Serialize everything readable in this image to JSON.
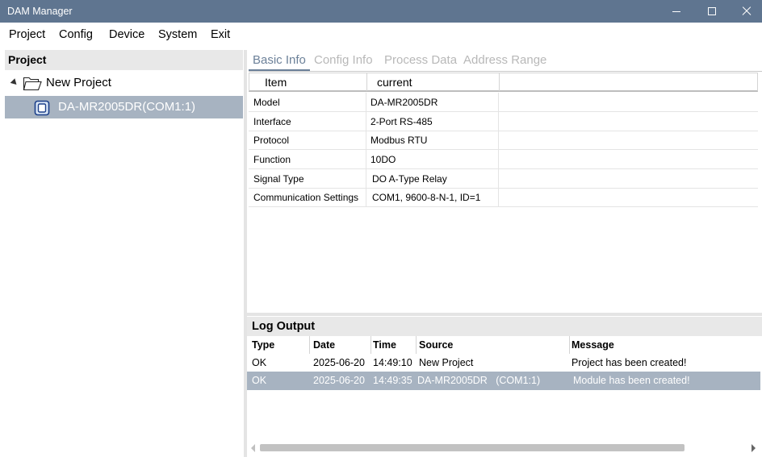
{
  "window": {
    "title": "DAM Manager"
  },
  "menu": [
    "Project",
    "Config",
    "Device",
    "System",
    "Exit"
  ],
  "project_panel": {
    "header": "Project",
    "tree": {
      "root": "New Project",
      "device": "DA-MR2005DR(COM1:1)"
    }
  },
  "tabs": [
    {
      "label": "Basic Info",
      "active": true
    },
    {
      "label": "Config Info",
      "active": false
    },
    {
      "label": "Process Data",
      "active": false
    },
    {
      "label": "Address Range",
      "active": false
    }
  ],
  "info_table": {
    "columns": [
      "Item",
      "current"
    ],
    "rows": [
      [
        "Model",
        "DA-MR2005DR"
      ],
      [
        "Interface",
        "2-Port RS-485"
      ],
      [
        "Protocol",
        "Modbus RTU"
      ],
      [
        "Function",
        "10DO"
      ],
      [
        "Signal Type",
        "DO A-Type Relay"
      ],
      [
        "Communication Settings",
        "COM1, 9600-8-N-1, ID=1"
      ]
    ]
  },
  "log": {
    "header": "Log Output",
    "columns": [
      "Type",
      "Date",
      "Time",
      "Source",
      "Message"
    ],
    "rows": [
      {
        "type": "OK",
        "date": "2025-06-20",
        "time": "14:49:10",
        "source": "New Project",
        "message": "Project has been created!",
        "selected": false
      },
      {
        "type": "OK",
        "date": "2025-06-20",
        "time": "14:49:35",
        "source": "DA-MR2005DR   (COM1:1)",
        "message": "Module has been created!",
        "selected": true
      }
    ]
  },
  "colors": {
    "titlebar": "#5f7590",
    "selection": "#a7b3c1",
    "tab_active": "#6c8199",
    "tab_inactive": "#b8b8b8"
  }
}
